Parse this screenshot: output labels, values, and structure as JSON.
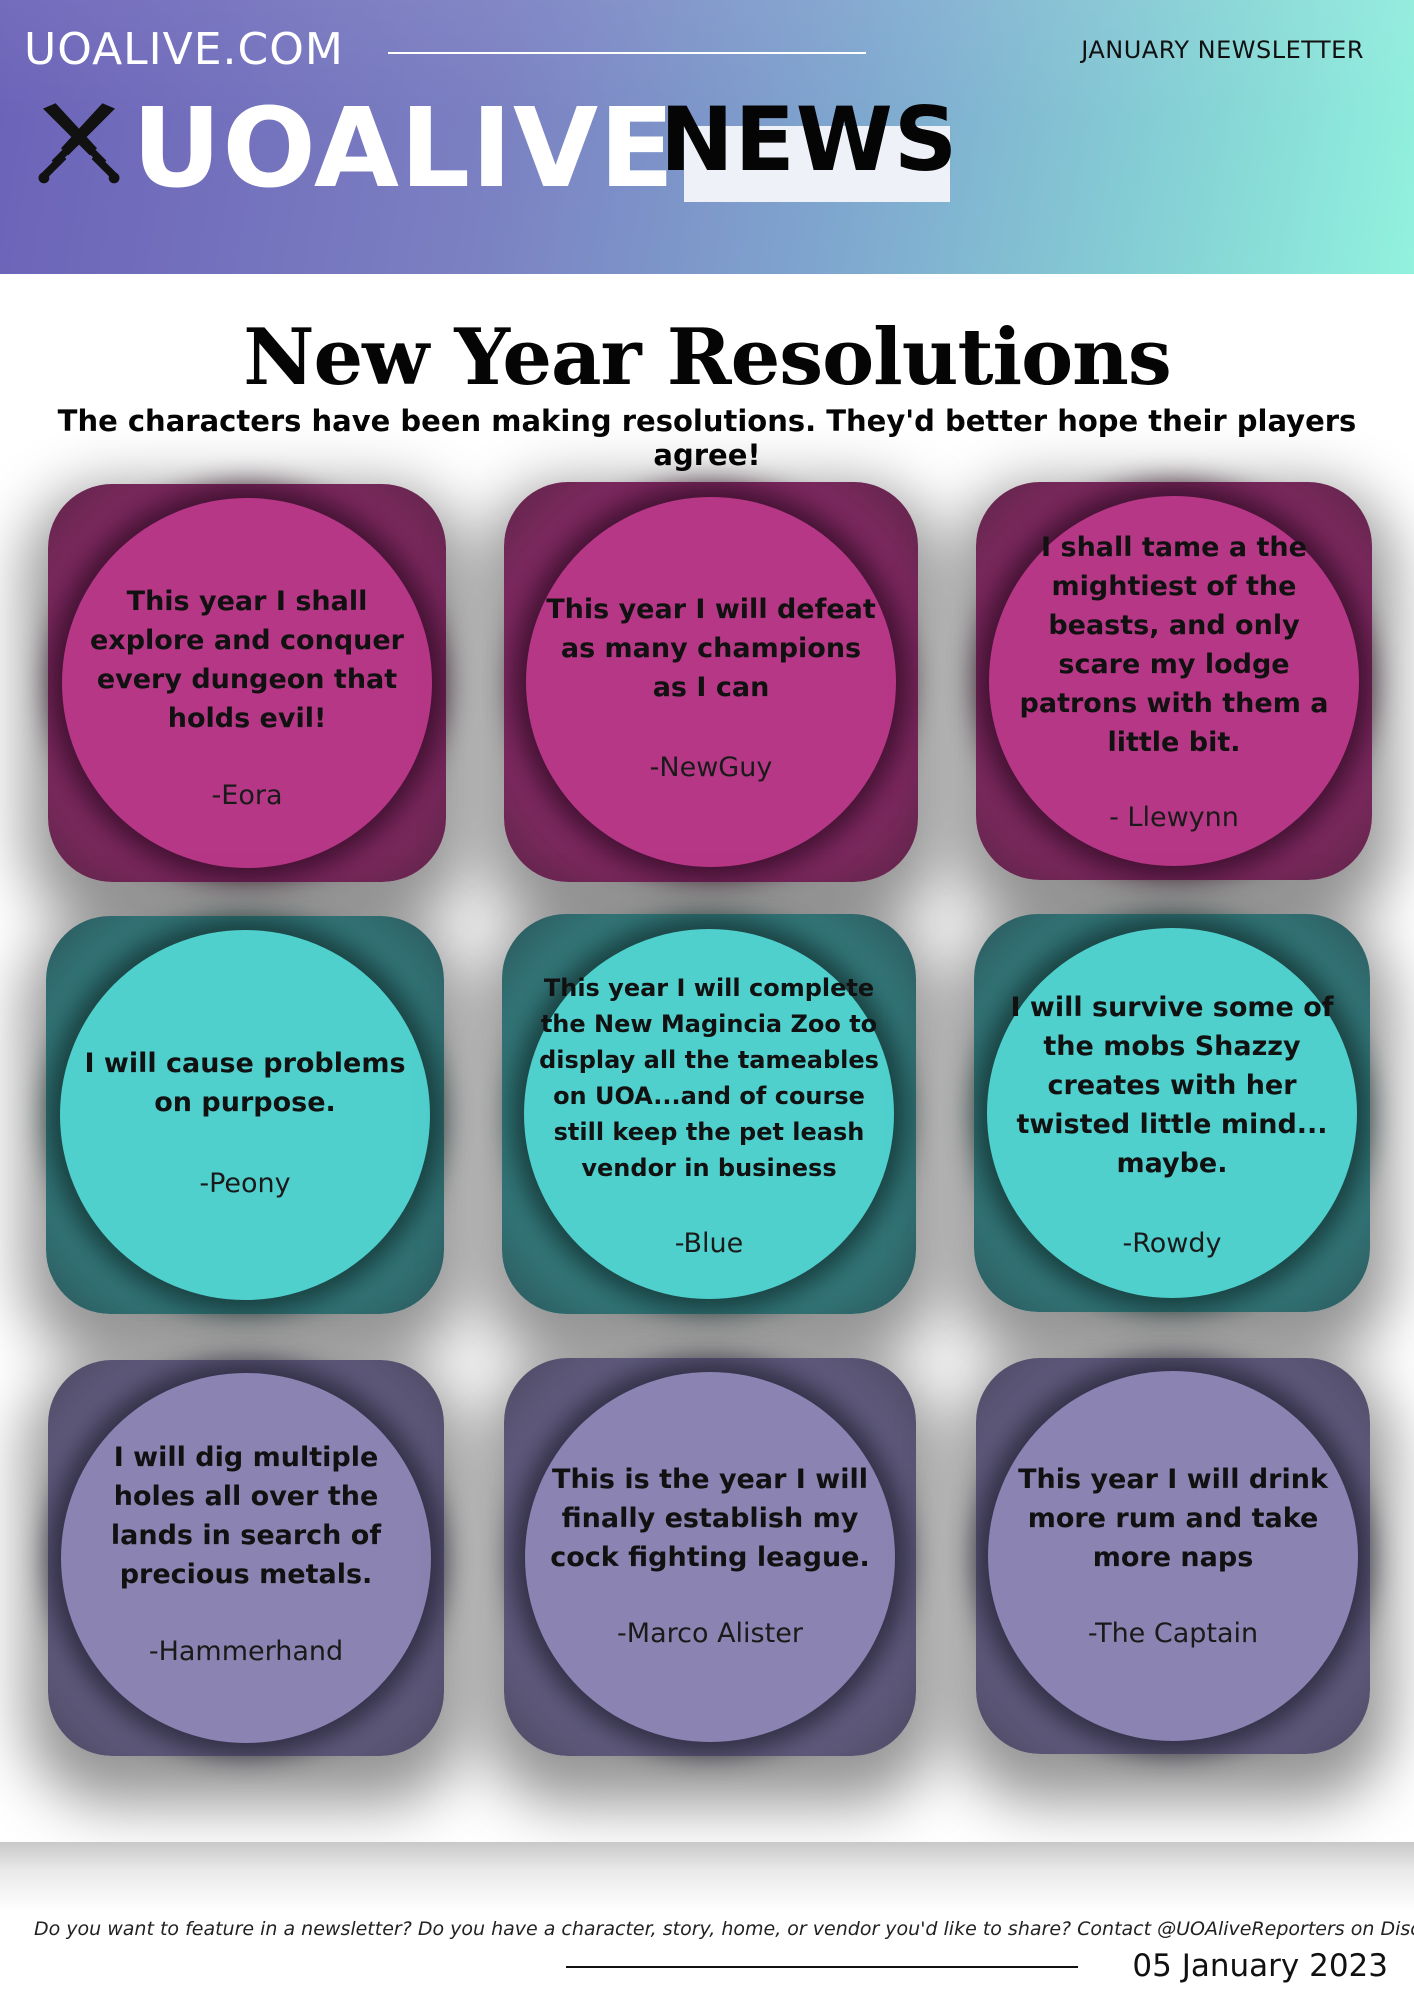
{
  "header": {
    "site": "UOALIVE.COM",
    "issue": "JANUARY NEWSLETTER",
    "brand": "UOALIVE",
    "section": "NEWS",
    "logo_icon": "crossed-swords-icon"
  },
  "page": {
    "title": "New Year Resolutions",
    "subtitle": "The characters have been making resolutions. They'd better hope their players agree!"
  },
  "cards": [
    {
      "quote": [
        "This year I shall",
        "explore and conquer",
        "every dungeon that",
        "holds evil!"
      ],
      "author": "-Eora",
      "color": "#b73787"
    },
    {
      "quote": [
        "This year I will defeat",
        "as many champions",
        "as I can"
      ],
      "author": "-NewGuy",
      "color": "#b73787"
    },
    {
      "quote": [
        "I shall tame a the",
        "mightiest of the",
        "beasts, and only",
        "scare my lodge",
        "patrons with them a",
        "little bit."
      ],
      "author": "- Llewynn",
      "color": "#b73787"
    },
    {
      "quote": [
        "I will cause problems",
        "on purpose."
      ],
      "author": "-Peony",
      "color": "#50d0cd"
    },
    {
      "quote": [
        "This year I will complete",
        "the New Magincia Zoo to",
        "display all the tameables",
        "on UOA...and of course",
        "still keep the pet leash",
        "vendor in business"
      ],
      "author": "-Blue",
      "color": "#50d0cd"
    },
    {
      "quote": [
        "I will survive some of",
        "the mobs Shazzy",
        "creates with her",
        "twisted little mind...",
        "maybe."
      ],
      "author": "-Rowdy",
      "color": "#50d0cd"
    },
    {
      "quote": [
        "I will dig multiple",
        "holes all over the",
        "lands in search of",
        "precious metals."
      ],
      "author": "-Hammerhand",
      "color": "#8b83b1"
    },
    {
      "quote": [
        "This is the year I will",
        "finally establish my",
        "cock fighting league."
      ],
      "author": "-Marco Alister",
      "color": "#8b83b1"
    },
    {
      "quote": [
        "This year I will drink",
        "more rum and take",
        "more naps"
      ],
      "author": "-The Captain",
      "color": "#8b83b1"
    }
  ],
  "footer": {
    "text": "Do you want to feature in a newsletter? Do you have a character, story, home, or vendor you'd like to share? Contact @UOAliveReporters  on Discord",
    "date": "05 January 2023"
  }
}
